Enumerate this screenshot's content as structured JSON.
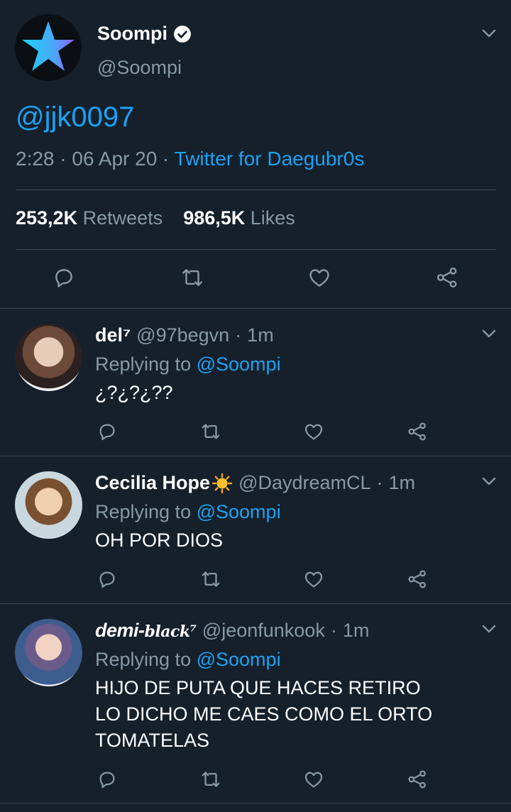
{
  "tweet": {
    "author_name": "Soompi",
    "author_handle": "@Soompi",
    "text": "@jjk0097",
    "time": "2:28",
    "date": "06 Apr 20",
    "source": "Twitter for Daegubr0s",
    "retweet_count": "253,2K",
    "retweet_label": "Retweets",
    "like_count": "986,5K",
    "like_label": "Likes"
  },
  "replies": [
    {
      "name": "del⁷",
      "handle": "@97begvn",
      "time": "1m",
      "replying_prefix": "Replying to",
      "replying_to": "@Soompi",
      "lines": [
        "¿?¿?¿??"
      ]
    },
    {
      "name": "Cecilia Hope",
      "handle": "@DaydreamCL",
      "time": "1m",
      "replying_prefix": "Replying to",
      "replying_to": "@Soompi",
      "lines": [
        "OH POR DIOS"
      ]
    },
    {
      "name": "demi-",
      "name_suffix": "black⁷",
      "handle": "@jeonfunkook",
      "time": "1m",
      "replying_prefix": "Replying to",
      "replying_to": "@Soompi",
      "lines": [
        "HIJO DE PUTA QUE HACES RETIRO",
        "LO DICHO ME CAES COMO EL ORTO",
        "TOMATELAS"
      ]
    }
  ],
  "sep": "·",
  "colors": {
    "background": "#15202b",
    "accent": "#1da1f2",
    "muted": "#8899a6",
    "divider": "#38444d"
  },
  "icons": [
    "verified-icon",
    "chevron-down-icon",
    "reply-icon",
    "retweet-icon",
    "like-icon",
    "share-icon",
    "sun-emoji"
  ]
}
